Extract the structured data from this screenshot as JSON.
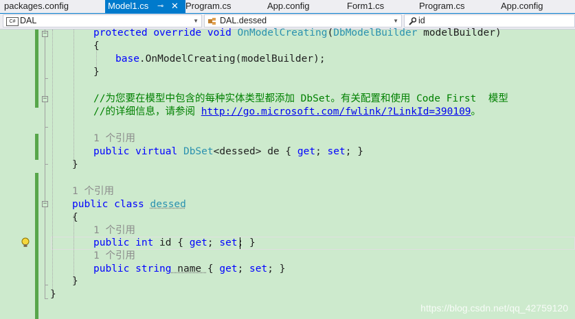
{
  "tabs": [
    {
      "label": "packages.config",
      "active": false
    },
    {
      "label": "Model1.cs",
      "active": true
    },
    {
      "label": "Program.cs",
      "active": false
    },
    {
      "label": "App.config",
      "active": false
    },
    {
      "label": "Form1.cs",
      "active": false
    },
    {
      "label": "Program.cs",
      "active": false
    },
    {
      "label": "App.config",
      "active": false
    }
  ],
  "tab_icons": {
    "pin": "pin-icon",
    "close": "close-icon"
  },
  "nav": {
    "project": {
      "label": "DAL",
      "icon": "csharp-project-icon",
      "badge": "C#"
    },
    "type": {
      "label": "DAL.dessed",
      "icon": "class-icon"
    },
    "member": {
      "label": "id",
      "icon": "wrench-property-icon"
    }
  },
  "code": {
    "l1": {
      "kw1": "protected",
      "kw2": "override",
      "kw3": "void",
      "method": "OnModelCreating",
      "paren_open": "(",
      "type": "DbModelBuilder",
      "rest": " modelBuilder)"
    },
    "l2": "{",
    "l3": {
      "kw": "base",
      "rest": ".OnModelCreating(modelBuilder);"
    },
    "l4": "}",
    "l5": "//为您要在模型中包含的每种实体类型都添加 DbSet。有关配置和使用 Code First  模型",
    "l6": {
      "prefix": "//的详细信息，请参阅 ",
      "link": "http://go.microsoft.com/fwlink/?LinkId=390109",
      "suffix": "。"
    },
    "lens_refs": "1 个引用",
    "l7": {
      "kw1": "public",
      "kw2": "virtual",
      "type": "DbSet",
      "generic": "<dessed>",
      "name": " de ",
      "brace_open": "{ ",
      "kw_get": "get",
      "semi1": "; ",
      "kw_set": "set",
      "semi2": "; }"
    },
    "l8": "}",
    "l9": {
      "kw1": "public",
      "kw2": "class",
      "type": "dessed"
    },
    "l10": "{",
    "l11": {
      "kw1": "public",
      "kw2": "int",
      "name": " id ",
      "brace_open": "{ ",
      "kw_get": "get",
      "semi1": "; ",
      "kw_set": "set",
      "semi2": "; }"
    },
    "l12": {
      "kw1": "public",
      "kw2": "string",
      "name": " name ",
      "brace_open": "{ ",
      "kw_get": "get",
      "semi1": "; ",
      "kw_set": "set",
      "semi2": "; }"
    },
    "l13": "}",
    "l14": "}"
  },
  "lightbulb_icon": "lightbulb-icon",
  "watermark": "https://blog.csdn.net/qq_42759120",
  "colors": {
    "background": "#cdeacd",
    "keyword": "#0000ff",
    "type": "#2b91af",
    "comment": "#008000",
    "accent": "#007acc"
  }
}
